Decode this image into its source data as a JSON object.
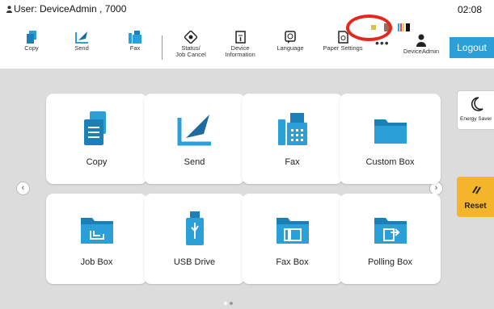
{
  "header": {
    "user_label": "User: DeviceAdmin , 7000",
    "clock": "02:08",
    "logout_label": "Logout",
    "more_label": "•••",
    "toolbar": [
      {
        "label_line1": "Copy",
        "label_line2": "",
        "icon": "copy-icon"
      },
      {
        "label_line1": "Send",
        "label_line2": "",
        "icon": "send-icon"
      },
      {
        "label_line1": "Fax",
        "label_line2": "",
        "icon": "fax-icon"
      },
      {
        "label_line1": "Status/",
        "label_line2": "Job Cancel",
        "icon": "status-icon"
      },
      {
        "label_line1": "Device",
        "label_line2": "Information",
        "icon": "device-info-icon"
      },
      {
        "label_line1": "Language",
        "label_line2": "",
        "icon": "language-icon"
      },
      {
        "label_line1": "Paper Settings",
        "label_line2": "",
        "icon": "paper-settings-icon"
      },
      {
        "label_line1": "DeviceAdmin",
        "label_line2": "",
        "icon": "user-icon"
      }
    ]
  },
  "tiles": [
    {
      "label": "Copy",
      "icon": "copy-icon"
    },
    {
      "label": "Send",
      "icon": "send-icon"
    },
    {
      "label": "Fax",
      "icon": "fax-icon"
    },
    {
      "label": "Custom Box",
      "icon": "folder-icon"
    },
    {
      "label": "Job Box",
      "icon": "job-box-icon"
    },
    {
      "label": "USB Drive",
      "icon": "usb-drive-icon"
    },
    {
      "label": "Fax Box",
      "icon": "fax-box-icon"
    },
    {
      "label": "Polling Box",
      "icon": "polling-box-icon"
    }
  ],
  "side": {
    "energy_label": "Energy Saver",
    "reset_label": "Reset"
  },
  "nav": {
    "left_arrow": "‹",
    "right_arrow": "›"
  },
  "colors": {
    "accent_blue": "#2ba0d8",
    "reset_yellow": "#f5b52a",
    "highlight_red": "#e8261c",
    "background": "#dcdcdc"
  },
  "pager": {
    "current_page": 1,
    "total_pages": 2
  }
}
